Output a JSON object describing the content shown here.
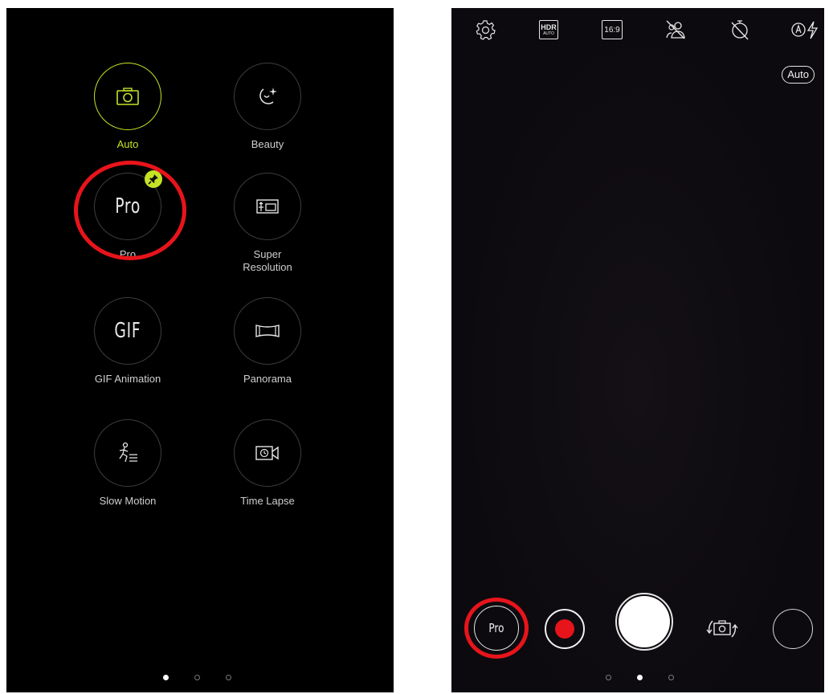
{
  "left": {
    "modes": [
      {
        "id": "auto",
        "label": "Auto",
        "icon": "camera-icon",
        "active": true
      },
      {
        "id": "beauty",
        "label": "Beauty",
        "icon": "beauty-sparkle-icon"
      },
      {
        "id": "pro",
        "label": "Pro",
        "icon_text": "Pro",
        "pinned": true
      },
      {
        "id": "super-resolution",
        "label": "Super\nResolution",
        "icon": "super-resolution-icon"
      },
      {
        "id": "gif",
        "label": "GIF Animation",
        "icon_text": "GIF"
      },
      {
        "id": "panorama",
        "label": "Panorama",
        "icon": "panorama-icon"
      },
      {
        "id": "slow-motion",
        "label": "Slow Motion",
        "icon": "slow-motion-icon"
      },
      {
        "id": "time-lapse",
        "label": "Time Lapse",
        "icon": "time-lapse-icon"
      }
    ],
    "page_indicator": {
      "count": 3,
      "active": 0
    }
  },
  "right": {
    "top_icons": [
      "settings-icon",
      "hdr-auto-icon",
      "aspect-ratio-icon",
      "face-off-icon",
      "timer-off-icon",
      "flash-auto-icon"
    ],
    "hdr_text": "HDR",
    "hdr_sub": "AUTO",
    "ratio_text": "16:9",
    "auto_chip": "Auto",
    "mode_button_text": "Pro",
    "page_indicator": {
      "count": 3,
      "active": 1
    }
  },
  "colors": {
    "accent": "#c6e227",
    "annotation": "#e8141b",
    "record": "#e8141b"
  }
}
